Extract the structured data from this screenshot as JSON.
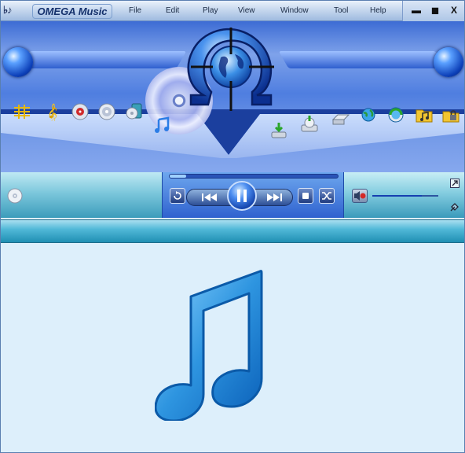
{
  "app": {
    "name": "OMEGA Music",
    "logo_icon": "music-notes-logo-icon"
  },
  "menu": [
    "File",
    "Edit",
    "Play",
    "View",
    "Window",
    "Tool",
    "Help"
  ],
  "window_controls": {
    "minimize": "▬",
    "maximize": "◼",
    "close": "X"
  },
  "toolbar_icons": [
    "equalizer-icon",
    "treble-clef-icon",
    "cd-red-icon",
    "cd-icon",
    "cd-mp3-icon",
    "music-note-icon",
    "import-disc-icon",
    "burn-disc-icon",
    "drive-icon",
    "network-globe-icon",
    "globe-sync-icon",
    "music-folder-icon",
    "lock-folder-icon"
  ],
  "player": {
    "seek_progress": 0.1,
    "volume_level": 0.75,
    "buttons": [
      "repeat-icon",
      "previous-icon",
      "pause-icon",
      "next-icon",
      "stop-icon",
      "shuffle-icon"
    ],
    "mute_icon": "speaker-mute-icon"
  },
  "colors": {
    "accent": "#3d6cd4",
    "player": "#2b8fb3",
    "content_bg": "#ddeffb",
    "note": "#2e95e0"
  }
}
